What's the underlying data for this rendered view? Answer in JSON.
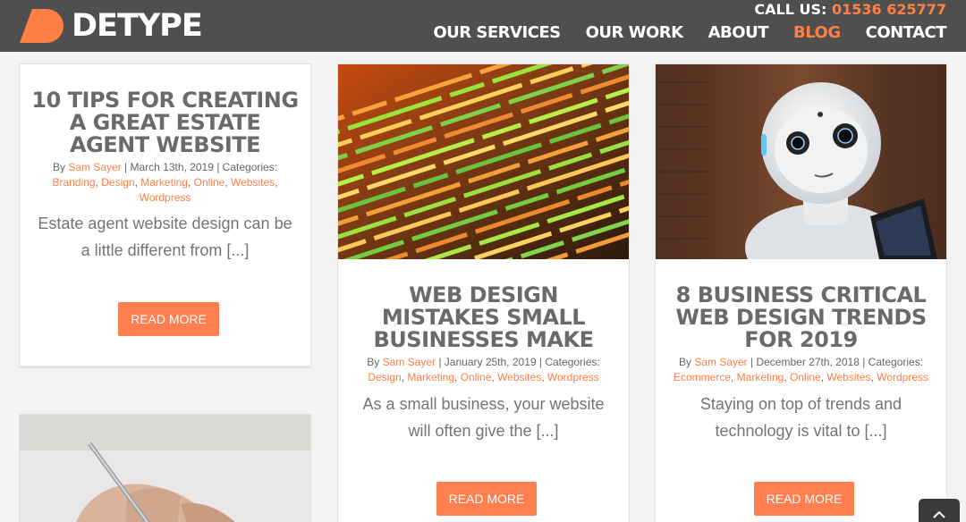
{
  "brand": {
    "name": "DETYPE",
    "accent": "#ff7f45"
  },
  "header": {
    "call_label": "CALL US:",
    "phone": "01536 625777",
    "nav": [
      {
        "label": "OUR SERVICES"
      },
      {
        "label": "OUR WORK"
      },
      {
        "label": "ABOUT"
      },
      {
        "label": "BLOG",
        "active": true
      },
      {
        "label": "CONTACT"
      }
    ]
  },
  "posts": [
    {
      "title": "10 TIPS FOR CREATING A GREAT ESTATE AGENT WEBSITE",
      "by": "By",
      "author": "Sam Sayer",
      "date": "March 13th, 2019",
      "categories_label": "Categories:",
      "categories": [
        "Branding",
        "Design",
        "Marketing",
        "Online",
        "Websites",
        "Wordpress"
      ],
      "excerpt": "Estate agent website design can be a little different from [...]",
      "button": "READ MORE"
    },
    {
      "title": "WEB DESIGN MISTAKES SMALL BUSINESSES MAKE",
      "by": "By",
      "author": "Sam Sayer",
      "date": "January 25th, 2019",
      "categories_label": "Categories:",
      "categories": [
        "Design",
        "Marketing",
        "Online",
        "Websites",
        "Wordpress"
      ],
      "excerpt": "As a small business, your website will often give the [...]",
      "button": "READ MORE",
      "image": "code-screen"
    },
    {
      "title": "8 BUSINESS CRITICAL WEB DESIGN TRENDS FOR 2019",
      "by": "By",
      "author": "Sam Sayer",
      "date": "December 27th, 2018",
      "categories_label": "Categories:",
      "categories": [
        "Ecommerce",
        "Marketing",
        "Online",
        "Websites",
        "Wordpress"
      ],
      "excerpt": "Staying on top of trends and technology is vital to [...]",
      "button": "READ MORE",
      "image": "robot"
    },
    {
      "image": "hand-writing"
    }
  ],
  "scroll_top_icon": "chevron-up-icon"
}
